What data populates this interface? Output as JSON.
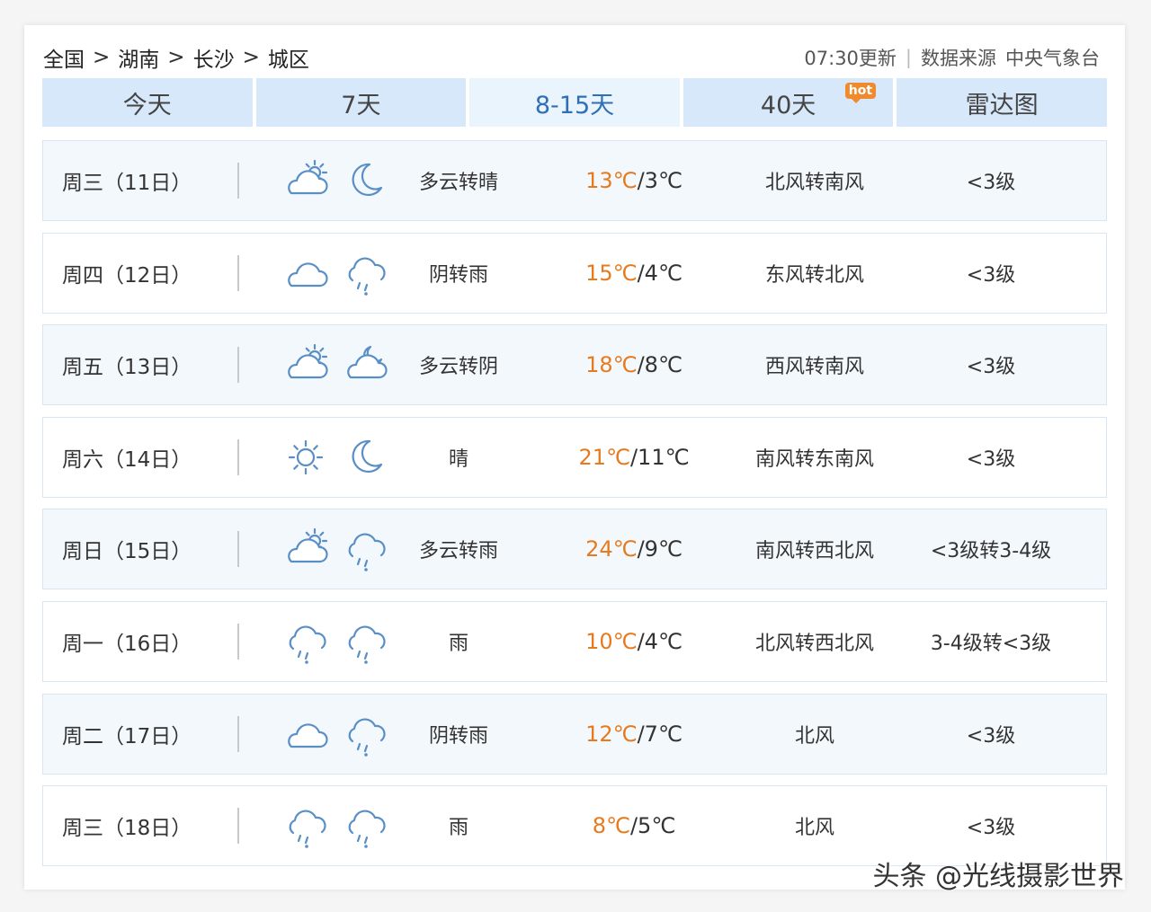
{
  "breadcrumb": [
    "全国",
    "湖南",
    "长沙",
    "城区"
  ],
  "breadcrumb_sep": ">",
  "update": {
    "time": "07:30更新",
    "divider": "|",
    "source_label": "数据来源",
    "source_name": "中央气象台"
  },
  "tabs": [
    {
      "label": "今天"
    },
    {
      "label": "7天"
    },
    {
      "label": "8-15天",
      "active": true
    },
    {
      "label": "40天",
      "badge": "hot"
    },
    {
      "label": "雷达图"
    }
  ],
  "days": [
    {
      "date": "周三（11日）",
      "icon_day": "partly-cloudy-day-icon",
      "icon_night": "moon-icon",
      "desc": "多云转晴",
      "high": "13℃",
      "low": "3℃",
      "wind": "北风转南风",
      "level": "<3级"
    },
    {
      "date": "周四（12日）",
      "icon_day": "cloudy-icon",
      "icon_night": "rain-icon",
      "desc": "阴转雨",
      "high": "15℃",
      "low": "4℃",
      "wind": "东风转北风",
      "level": "<3级"
    },
    {
      "date": "周五（13日）",
      "icon_day": "partly-cloudy-day-icon",
      "icon_night": "partly-cloudy-night-icon",
      "desc": "多云转阴",
      "high": "18℃",
      "low": "8℃",
      "wind": "西风转南风",
      "level": "<3级"
    },
    {
      "date": "周六（14日）",
      "icon_day": "sun-icon",
      "icon_night": "moon-icon",
      "desc": "晴",
      "high": "21℃",
      "low": "11℃",
      "wind": "南风转东南风",
      "level": "<3级"
    },
    {
      "date": "周日（15日）",
      "icon_day": "partly-cloudy-day-icon",
      "icon_night": "rain-icon",
      "desc": "多云转雨",
      "high": "24℃",
      "low": "9℃",
      "wind": "南风转西北风",
      "level": "<3级转3-4级"
    },
    {
      "date": "周一（16日）",
      "icon_day": "rain-icon",
      "icon_night": "rain-icon",
      "desc": "雨",
      "high": "10℃",
      "low": "4℃",
      "wind": "北风转西北风",
      "level": "3-4级转<3级"
    },
    {
      "date": "周二（17日）",
      "icon_day": "cloudy-icon",
      "icon_night": "rain-icon",
      "desc": "阴转雨",
      "high": "12℃",
      "low": "7℃",
      "wind": "北风",
      "level": "<3级"
    },
    {
      "date": "周三（18日）",
      "icon_day": "rain-icon",
      "icon_night": "rain-icon",
      "desc": "雨",
      "high": "8℃",
      "low": "5℃",
      "wind": "北风",
      "level": "<3级"
    }
  ],
  "temp_sep": "/",
  "watermark": "头条 @光线摄影世界",
  "colors": {
    "accent_blue": "#2f6fb6",
    "tab_bg": "#d6e8f9",
    "tab_active_bg": "#eaf4fd",
    "high_temp": "#e67a1f",
    "icon_stroke": "#5a8fc6",
    "hot_badge": "#f08a2d",
    "row_shaded": "#f3f8fd"
  }
}
